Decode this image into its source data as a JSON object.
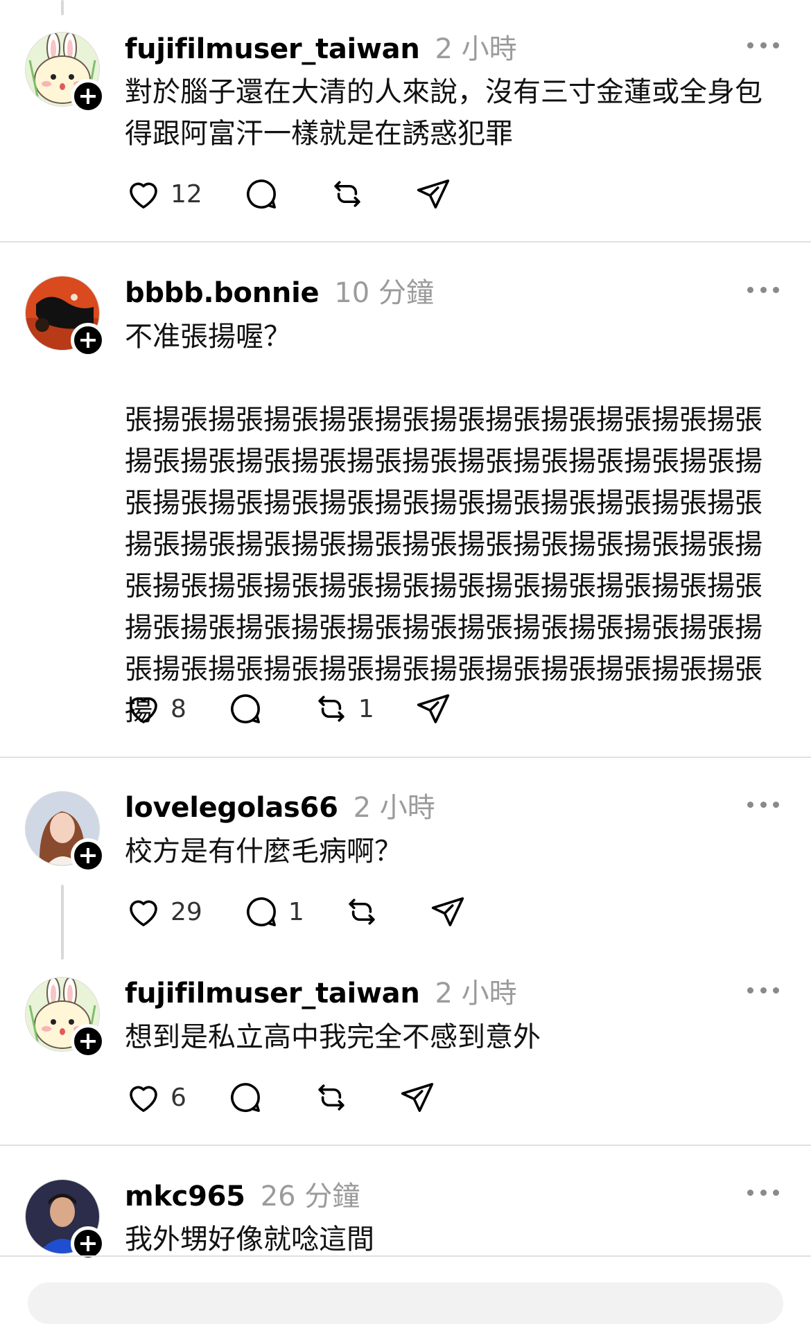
{
  "posts": [
    {
      "username": "fujifilmuser_taiwan",
      "time": "2 小時",
      "text": "對於腦子還在大清的人來說，沒有三寸金蓮或全身包得跟阿富汗一樣就是在誘惑犯罪",
      "likes": "12",
      "comments": "",
      "reposts": "",
      "avatar_icon": "bunny-character-avatar"
    },
    {
      "username": "bbbb.bonnie",
      "time": "10 分鐘",
      "text": "不准張揚喔？\n\n張揚張揚張揚張揚張揚張揚張揚張揚張揚張揚張揚張揚張揚張揚張揚張揚張揚張揚張揚張揚張揚張揚張揚張揚張揚張揚張揚張揚張揚張揚張揚張揚張揚張揚張揚張揚張揚張揚張揚張揚張揚張揚張揚張揚張揚張揚張揚張揚張揚張揚張揚張揚張揚張揚張揚張揚張揚張揚張揚張揚張揚張揚張揚張揚張揚張揚張揚張揚張揚張揚張揚張揚張揚張揚張揚張揚張揚張揚張揚張揚張揚",
      "likes": "8",
      "comments": "",
      "reposts": "1",
      "avatar_icon": "photo-avatar-dark"
    },
    {
      "username": "lovelegolas66",
      "time": "2 小時",
      "text": "校方是有什麼毛病啊？",
      "likes": "29",
      "comments": "1",
      "reposts": "",
      "avatar_icon": "photo-avatar-woman"
    },
    {
      "username": "fujifilmuser_taiwan",
      "time": "2 小時",
      "text": "想到是私立高中我完全不感到意外",
      "likes": "6",
      "comments": "",
      "reposts": "",
      "avatar_icon": "bunny-character-avatar"
    },
    {
      "username": "mkc965",
      "time": "26 分鐘",
      "text": "我外甥好像就唸這間",
      "likes": "",
      "comments": "",
      "reposts": "",
      "avatar_icon": "photo-avatar-man"
    }
  ],
  "icons": {
    "like": "heart-icon",
    "comment": "comment-bubble-icon",
    "repost": "repost-icon",
    "share": "send-icon",
    "more": "more-icon",
    "follow": "plus-icon"
  },
  "colors": {
    "username": "#000000",
    "time": "#9b9b9b",
    "divider": "#e1e1e1",
    "icon": "#000000"
  }
}
